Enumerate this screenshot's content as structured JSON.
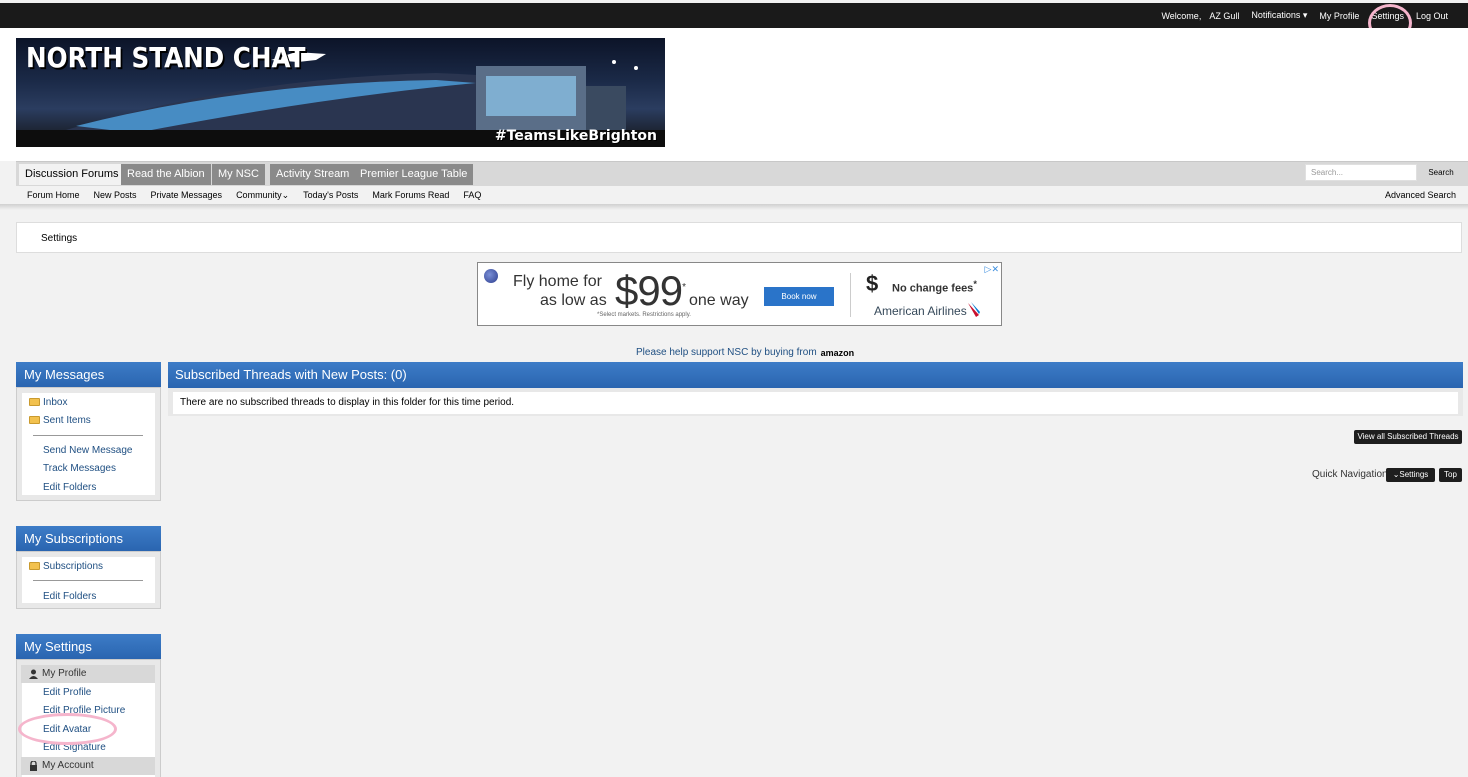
{
  "topbar": {
    "welcome": "Welcome,",
    "username": "AZ Gull",
    "notifications": "Notifications",
    "my_profile": "My Profile",
    "settings": "Settings",
    "logout": "Log Out"
  },
  "banner": {
    "title": "NORTH STAND CHAT",
    "hashtag": "#TeamsLikeBrighton"
  },
  "nav": {
    "tabs": [
      "Discussion Forums",
      "Read the Albion",
      "My NSC",
      "Activity Stream",
      "Premier League Table"
    ],
    "search_placeholder": "Search...",
    "search_button": "Search",
    "sublinks": [
      "Forum Home",
      "New Posts",
      "Private Messages",
      "Community",
      "Today's Posts",
      "Mark Forums Read",
      "FAQ"
    ],
    "advanced_search": "Advanced Search"
  },
  "breadcrumb": "Settings",
  "ad": {
    "line1": "Fly home for",
    "line2": "as low as",
    "price": "$99",
    "asterisk": "*",
    "oneway": "one way",
    "fine_print": "*Select markets. Restrictions apply.",
    "book_button": "Book now",
    "no_fees": "No change fees",
    "brand": "American Airlines"
  },
  "support": {
    "text": "Please help support NSC by buying from",
    "brand": "amazon"
  },
  "sidebar": {
    "messages": {
      "title": "My Messages",
      "folders": [
        "Inbox",
        "Sent Items"
      ],
      "links": [
        "Send New Message",
        "Track Messages",
        "Edit Folders"
      ]
    },
    "subscriptions": {
      "title": "My Subscriptions",
      "folders": [
        "Subscriptions"
      ],
      "links": [
        "Edit Folders"
      ]
    },
    "settings": {
      "title": "My Settings",
      "profile_group": "My Profile",
      "profile_links": [
        "Edit Profile",
        "Edit Profile Picture",
        "Edit Avatar",
        "Edit Signature"
      ],
      "account_group": "My Account"
    }
  },
  "main": {
    "title": "Subscribed Threads with New Posts: (0)",
    "empty_message": "There are no subscribed threads to display in this folder for this time period.",
    "view_all_button": "View all Subscribed Threads",
    "quick_nav_label": "Quick Navigation",
    "quick_nav_select": "Settings",
    "top_button": "Top"
  },
  "colors": {
    "panel_blue": "#2a65b0",
    "topbar": "#1a1a1a",
    "annotation_circle": "#f5b5cc"
  }
}
